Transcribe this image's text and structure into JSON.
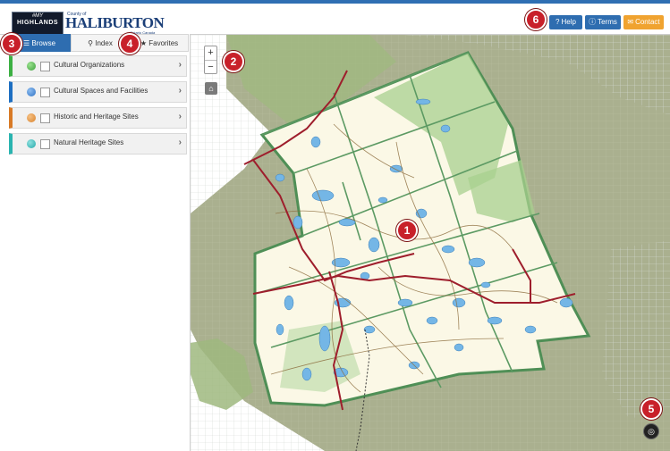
{
  "header": {
    "logo_dark_line1": "#MY",
    "logo_dark_line2": "HIGHLANDS",
    "logo_county": "County of",
    "logo_name": "HALIBURTON",
    "logo_sub": "Ontario Canada",
    "buttons": [
      {
        "label": "Help",
        "icon": "question-circle-icon",
        "color": "#2e6db0"
      },
      {
        "label": "Terms",
        "icon": "info-circle-icon",
        "color": "#2e6db0"
      },
      {
        "label": "Contact",
        "icon": "envelope-icon",
        "color": "#f0a330"
      }
    ]
  },
  "tabs": [
    {
      "label": "Browse",
      "icon": "list-icon",
      "active": true
    },
    {
      "label": "Index",
      "icon": "search-icon",
      "active": false
    },
    {
      "label": "Favorites",
      "icon": "star-icon",
      "active": false
    }
  ],
  "categories": [
    {
      "label": "Cultural Organizations",
      "color": "#3cb043",
      "ball": "#3ca03c"
    },
    {
      "label": "Cultural Spaces and Facilities",
      "color": "#1e6fc2",
      "ball": "#2f72c4"
    },
    {
      "label": "Historic and Heritage Sites",
      "color": "#d87a26",
      "ball": "#d9822b"
    },
    {
      "label": "Natural Heritage Sites",
      "color": "#2ab4b0",
      "ball": "#23a9a9"
    }
  ],
  "map": {
    "zoom_in": "+",
    "zoom_out": "−",
    "home_icon": "home-icon",
    "locate_icon": "locate-icon",
    "colors": {
      "grid": "#cfd6cf",
      "outside": "#a9ae91",
      "county": "#fbf8e6",
      "green": "#a6cc8f",
      "lake": "#7fbde8",
      "road": "#9e1e2c"
    }
  },
  "callouts": [
    "1",
    "2",
    "3",
    "4",
    "5",
    "6"
  ]
}
